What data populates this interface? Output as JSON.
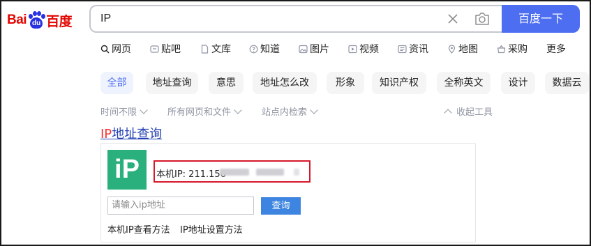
{
  "logo": {
    "text_left": "Bai",
    "paw_text": "du",
    "text_right": "百度"
  },
  "search": {
    "query": "IP",
    "button_label": "百度一下"
  },
  "nav": {
    "items": [
      {
        "label": "网页",
        "icon": "search-icon",
        "active": true
      },
      {
        "label": "贴吧",
        "icon": "tieba-icon"
      },
      {
        "label": "文库",
        "icon": "document-icon"
      },
      {
        "label": "知道",
        "icon": "question-icon"
      },
      {
        "label": "图片",
        "icon": "image-icon"
      },
      {
        "label": "视频",
        "icon": "play-icon"
      },
      {
        "label": "资讯",
        "icon": "news-icon"
      },
      {
        "label": "地图",
        "icon": "map-pin-icon"
      },
      {
        "label": "采购",
        "icon": "basket-icon"
      },
      {
        "label": "更多",
        "icon": ""
      }
    ]
  },
  "chips": [
    "全部",
    "地址查询",
    "意思",
    "地址怎么改",
    "形象",
    "知识产权",
    "全称英文",
    "设计",
    "数据云"
  ],
  "tools": {
    "time": "时间不限",
    "filetype": "所有网页和文件",
    "site": "站点内检索",
    "collapse": "收起工具"
  },
  "result": {
    "title_em": "IP",
    "title_rest": "地址查询",
    "ip_logo_text": "iP",
    "ip_label": "本机IP: 211.156",
    "input_placeholder": "请输入ip地址",
    "query_button": "查询",
    "links": [
      "本机IP查看方法",
      "IP地址设置方法"
    ]
  },
  "colors": {
    "brand_red": "#e10601",
    "brand_blue": "#2932e1",
    "accent": "#4e6ef2",
    "ip_green": "#2ab07c",
    "highlight_red": "#d6172a"
  }
}
